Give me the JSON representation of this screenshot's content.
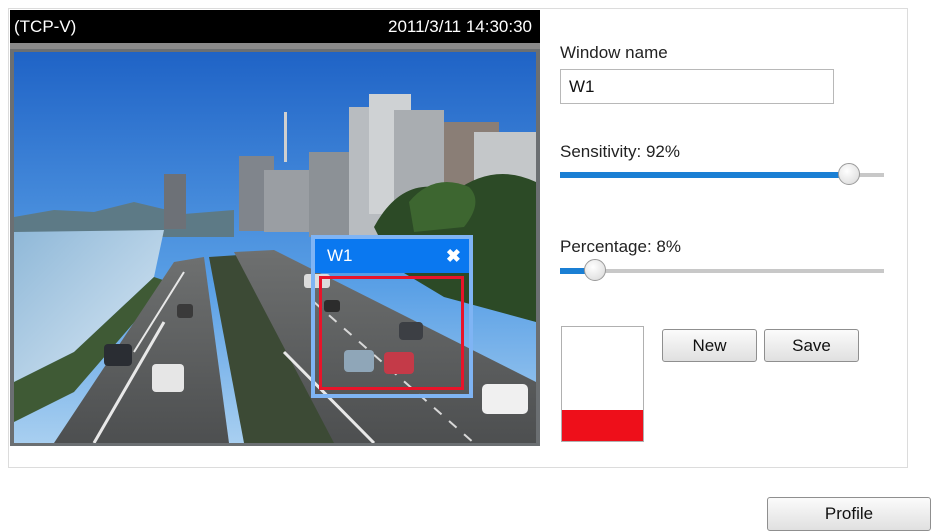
{
  "video": {
    "stream_label": "(TCP-V)",
    "timestamp": "2011/3/11 14:30:30"
  },
  "motion_window": {
    "name": "W1",
    "close_symbol": "✖"
  },
  "settings": {
    "window_name_label": "Window name",
    "window_name_value": "W1",
    "sensitivity_label": "Sensitivity: 92%",
    "sensitivity_value": 0.92,
    "percentage_label": "Percentage: 8%",
    "percentage_value": 0.08,
    "motion_level": 0.27
  },
  "buttons": {
    "new_label": "New",
    "save_label": "Save",
    "profile_label": "Profile"
  },
  "colors": {
    "accent": "#1a7fd4",
    "window_bar": "#0a78f0",
    "detection_area": "#e8142a",
    "level": "#ee0f1a"
  }
}
